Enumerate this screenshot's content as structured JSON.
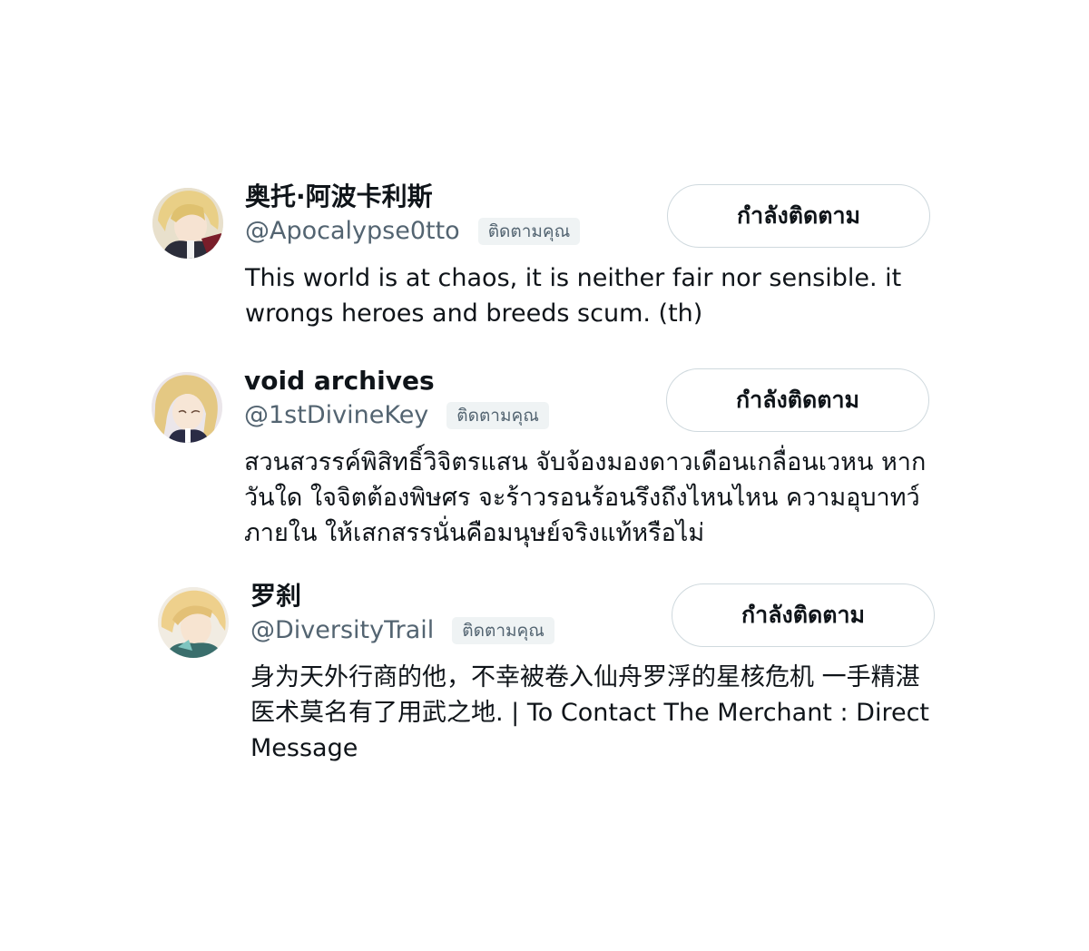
{
  "users": [
    {
      "name": "奥托·阿波卡利斯",
      "handle": "@Apocalypse0tto",
      "follows_you_label": "ติดตามคุณ",
      "bio": "This world is at chaos, it is neither fair nor sensible. it wrongs heroes and breeds scum. (th)",
      "button_label": "กำลังติดตาม"
    },
    {
      "name": "void archives",
      "handle": "@1stDivineKey",
      "follows_you_label": "ติดตามคุณ",
      "bio": "สวนสวรรค์พิสิทธิ์วิจิตรแสน จับจ้องมองดาวเดือนเกลื่อนเวหน หากวันใด ใจจิตต้องพิษศร จะร้าวรอนร้อนรึงถึงไหนไหน ความอุบาทว์ภายใน ให้เสกสรรนั่นคือมนุษย์จริงแท้หรือไม่",
      "button_label": "กำลังติดตาม"
    },
    {
      "name": "罗刹",
      "handle": "@DiversityTrail",
      "follows_you_label": "ติดตามคุณ",
      "bio": "身为天外行商的他，不幸被卷入仙舟罗浮的星核危机 一手精湛医术莫名有了用武之地. | To Contact The Merchant : Direct Message",
      "button_label": "กำลังติดตาม"
    }
  ],
  "colors": {
    "text": "#0f1419",
    "secondary": "#536471",
    "badge_bg": "#eff3f4",
    "button_border": "#cfd9de"
  }
}
